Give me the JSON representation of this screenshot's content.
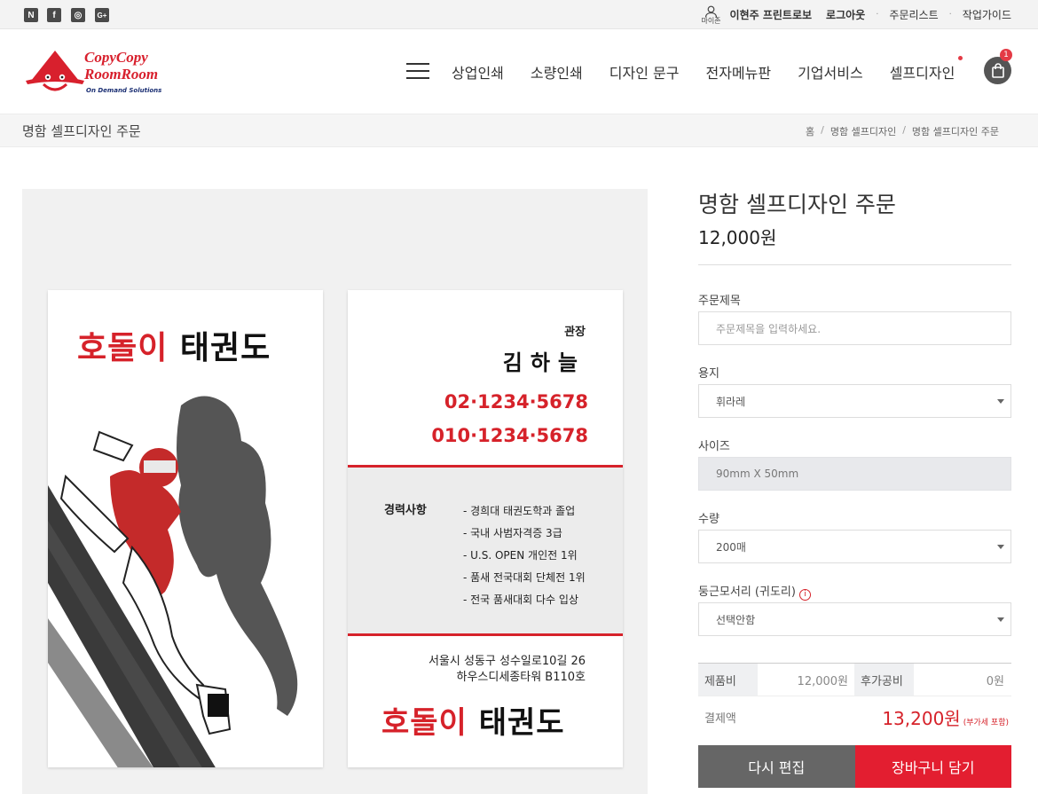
{
  "topbar": {
    "social": [
      "N",
      "f",
      "◎",
      "G+"
    ],
    "user_icon_label": "마이존",
    "user_name": "이현주 프린트로보",
    "logout": "로그아웃",
    "order_list": "주문리스트",
    "guide": "작업가이드"
  },
  "logo": {
    "line1": "CopyCopy",
    "line2": "RoomRoom",
    "tagline": "On Demand Solutions"
  },
  "nav": {
    "items": [
      "상업인쇄",
      "소량인쇄",
      "디자인 문구",
      "전자메뉴판",
      "기업서비스",
      "셀프디자인"
    ],
    "cart_count": "1"
  },
  "breadcrumb": {
    "page_title": "명함 셀프디자인 주문",
    "home": "홈",
    "level1": "명함 셀프디자인",
    "level2": "명함 셀프디자인 주문"
  },
  "card_front": {
    "title_red": "호돌이",
    "title_black": "태권도"
  },
  "card_back": {
    "role": "관장",
    "name": "김하늘",
    "phone1": "02·1234·5678",
    "phone2": "010·1234·5678",
    "career_label": "경력사항",
    "career": [
      "- 경희대 태권도학과 졸업",
      "- 국내 사범자격증 3급",
      "- U.S. OPEN 개인전 1위",
      "- 품새 전국대회 단체전 1위",
      "- 전국 품새대회 다수 입상"
    ],
    "address1": "서울시 성동구 성수일로10길 26",
    "address2": "하우스디세종타워 B110호",
    "title_red": "호돌이",
    "title_black": "태권도"
  },
  "form": {
    "title": "명함 셀프디자인 주문",
    "price": "12,000원",
    "order_title_label": "주문제목",
    "order_title_placeholder": "주문제목을 입력하세요.",
    "paper_label": "용지",
    "paper_value": "휘라레",
    "size_label": "사이즈",
    "size_value": "90mm X 50mm",
    "qty_label": "수량",
    "qty_value": "200매",
    "corner_label": "둥근모서리 (귀도리)",
    "corner_value": "선택안함",
    "product_cost_label": "제품비",
    "product_cost": "12,000원",
    "post_cost_label": "후가공비",
    "post_cost": "0원",
    "total_label": "결제액",
    "total": "13,200원",
    "vat_note": "(부가세 포함)",
    "reedit_button": "다시 편집",
    "cart_button": "장바구니 담기"
  },
  "colors": {
    "accent_red": "#e31e30",
    "brand_red": "#d8202d",
    "brand_navy": "#1b2f73",
    "gray_button": "#666666"
  }
}
